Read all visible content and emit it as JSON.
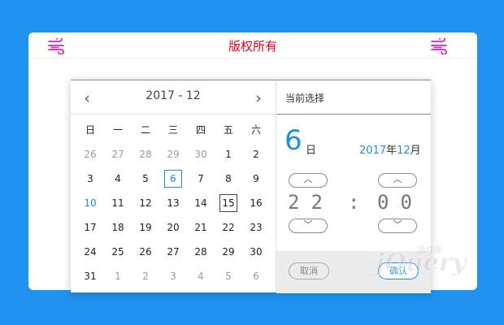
{
  "banner": {
    "title": "版权所有"
  },
  "picker": {
    "header": {
      "prev": "‹",
      "next": "›",
      "year_month": "2017 - 12"
    },
    "weekdays": [
      "日",
      "一",
      "二",
      "三",
      "四",
      "五",
      "六"
    ],
    "days": [
      {
        "label": "26",
        "kind": "muted"
      },
      {
        "label": "27",
        "kind": "muted"
      },
      {
        "label": "28",
        "kind": "muted"
      },
      {
        "label": "29",
        "kind": "muted"
      },
      {
        "label": "30",
        "kind": "muted"
      },
      {
        "label": "1",
        "kind": "normal"
      },
      {
        "label": "2",
        "kind": "normal"
      },
      {
        "label": "3",
        "kind": "normal"
      },
      {
        "label": "4",
        "kind": "normal"
      },
      {
        "label": "5",
        "kind": "normal"
      },
      {
        "label": "6",
        "kind": "selected"
      },
      {
        "label": "7",
        "kind": "normal"
      },
      {
        "label": "8",
        "kind": "normal"
      },
      {
        "label": "9",
        "kind": "normal"
      },
      {
        "label": "10",
        "kind": "sunday"
      },
      {
        "label": "11",
        "kind": "normal"
      },
      {
        "label": "12",
        "kind": "normal"
      },
      {
        "label": "13",
        "kind": "normal"
      },
      {
        "label": "14",
        "kind": "normal"
      },
      {
        "label": "15",
        "kind": "today"
      },
      {
        "label": "16",
        "kind": "normal"
      },
      {
        "label": "17",
        "kind": "normal"
      },
      {
        "label": "18",
        "kind": "normal"
      },
      {
        "label": "19",
        "kind": "normal"
      },
      {
        "label": "20",
        "kind": "normal"
      },
      {
        "label": "21",
        "kind": "normal"
      },
      {
        "label": "22",
        "kind": "normal"
      },
      {
        "label": "23",
        "kind": "normal"
      },
      {
        "label": "24",
        "kind": "normal"
      },
      {
        "label": "25",
        "kind": "normal"
      },
      {
        "label": "26",
        "kind": "normal"
      },
      {
        "label": "27",
        "kind": "normal"
      },
      {
        "label": "28",
        "kind": "normal"
      },
      {
        "label": "29",
        "kind": "normal"
      },
      {
        "label": "30",
        "kind": "normal"
      },
      {
        "label": "31",
        "kind": "normal"
      },
      {
        "label": "1",
        "kind": "muted"
      },
      {
        "label": "2",
        "kind": "muted"
      },
      {
        "label": "3",
        "kind": "muted"
      },
      {
        "label": "4",
        "kind": "muted"
      },
      {
        "label": "5",
        "kind": "muted"
      },
      {
        "label": "6",
        "kind": "muted"
      }
    ],
    "selection": {
      "title": "当前选择",
      "day": "6",
      "day_unit": "日",
      "year": "2017",
      "year_suffix": "年",
      "month": "12",
      "month_suffix": "月",
      "hour": "22",
      "colon": ":",
      "minute": "00",
      "up_glyph": "︿",
      "down_glyph": "﹀",
      "cancel": "取消",
      "confirm": "确认"
    }
  },
  "colors": {
    "background": "#1f93ef",
    "accent": "#1d8fe4",
    "banner_title": "#e5001d",
    "wind_icon": "#e11fc3"
  },
  "icons": {
    "banner_left": "wind-icon",
    "banner_right": "wind-icon"
  },
  "watermark": {
    "text": "jQuery 插件库"
  }
}
